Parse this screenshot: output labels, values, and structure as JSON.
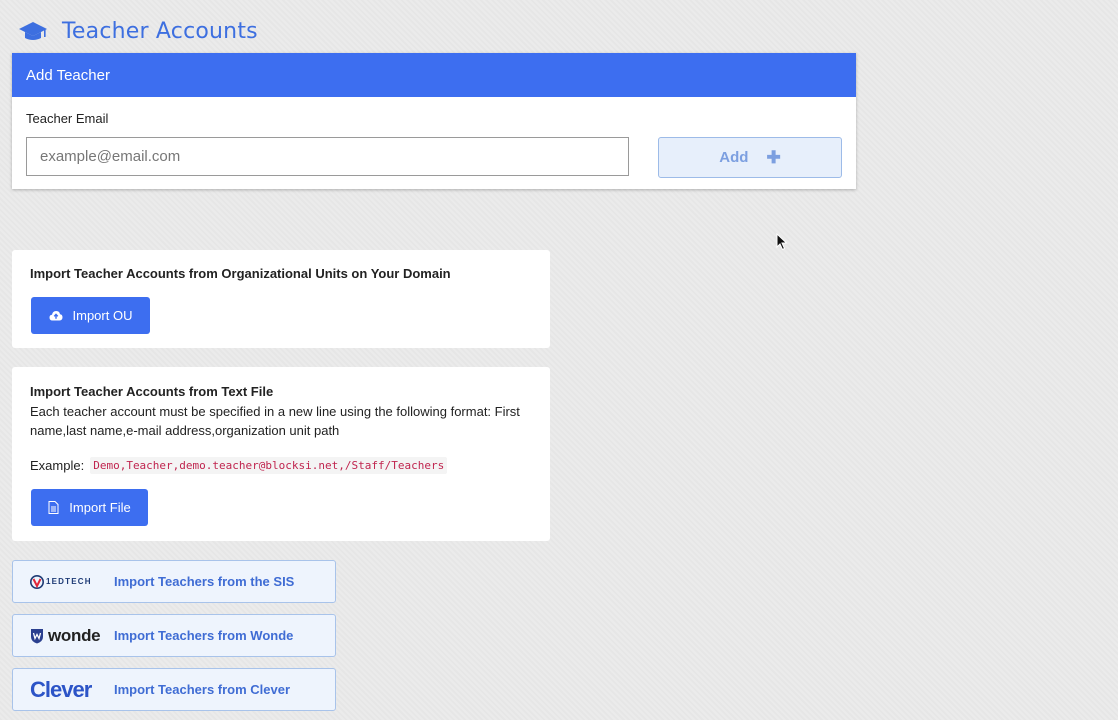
{
  "header": {
    "title": "Teacher Accounts",
    "icon": "graduation-cap-icon",
    "accent_color": "#3d6fe0"
  },
  "add_teacher": {
    "heading": "Add Teacher",
    "email_label": "Teacher Email",
    "email_placeholder": "example@email.com",
    "email_value": "",
    "add_label": "Add",
    "add_icon": "plus-icon"
  },
  "import_ou": {
    "title": "Import Teacher Accounts from Organizational Units on Your Domain",
    "button_label": "Import OU",
    "button_icon": "cloud-upload-icon"
  },
  "import_file": {
    "title": "Import Teacher Accounts from Text File",
    "description": "Each teacher account must be specified in a new line using the following format: First name,last name,e-mail address,organization unit path",
    "example_label": "Example:",
    "example_code": "Demo,Teacher,demo.teacher@blocksi.net,/Staff/Teachers",
    "button_label": "Import File",
    "button_icon": "file-icon"
  },
  "integrations": [
    {
      "logo_text": "1EDTECH",
      "label": "Import Teachers from the SIS",
      "icon": "1edtech-logo-icon"
    },
    {
      "logo_text": "wonde",
      "label": "Import Teachers from Wonde",
      "icon": "wonde-logo-icon"
    },
    {
      "logo_text": "Clever",
      "label": "Import Teachers from Clever",
      "icon": "clever-logo-icon"
    }
  ],
  "colors": {
    "primary": "#3d6ef0",
    "link_text": "#3f6cd4",
    "code_text": "#c0254f"
  }
}
